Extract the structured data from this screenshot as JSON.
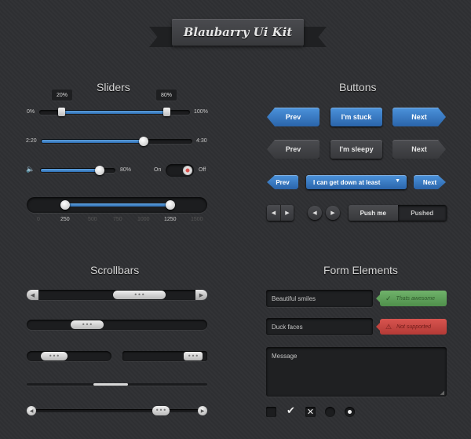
{
  "header": {
    "title": "Blaubarry Ui Kit"
  },
  "sliders": {
    "title": "Sliders",
    "range": {
      "min_label": "0%",
      "max_label": "100%",
      "low_tip": "20%",
      "high_tip": "80%",
      "low": 0.15,
      "high": 0.85
    },
    "time": {
      "start": "2:20",
      "end": "4:30",
      "value": 0.69
    },
    "volume": {
      "value_label": "80%",
      "value": 0.8
    },
    "toggle": {
      "on_label": "On",
      "off_label": "Off"
    },
    "scale": {
      "ticks": [
        "0",
        "250",
        "500",
        "750",
        "1000",
        "1250",
        "1500"
      ],
      "low_label": "250",
      "high_label": "1250"
    }
  },
  "buttons": {
    "title": "Buttons",
    "row1": {
      "prev": "Prev",
      "middle": "I'm stuck",
      "next": "Next"
    },
    "row2": {
      "prev": "Prev",
      "middle": "I'm sleepy",
      "next": "Next"
    },
    "row3": {
      "prev": "Prev",
      "dropdown": "I can get down at least",
      "next": "Next"
    },
    "segmented": {
      "pushme": "Push me",
      "pushed": "Pushed"
    }
  },
  "scrollbars": {
    "title": "Scrollbars",
    "thumb_glyph": "•••"
  },
  "form": {
    "title": "Form Elements",
    "field1": "Beautiful smiles",
    "field1_status": "Thats awesome",
    "field2": "Duck faces",
    "field2_status": "Not supported",
    "message_placeholder": "Message"
  },
  "colors": {
    "accent": "#3a7fc8",
    "success": "#5fa15a",
    "error": "#c4443f",
    "bg": "#2f3033"
  }
}
